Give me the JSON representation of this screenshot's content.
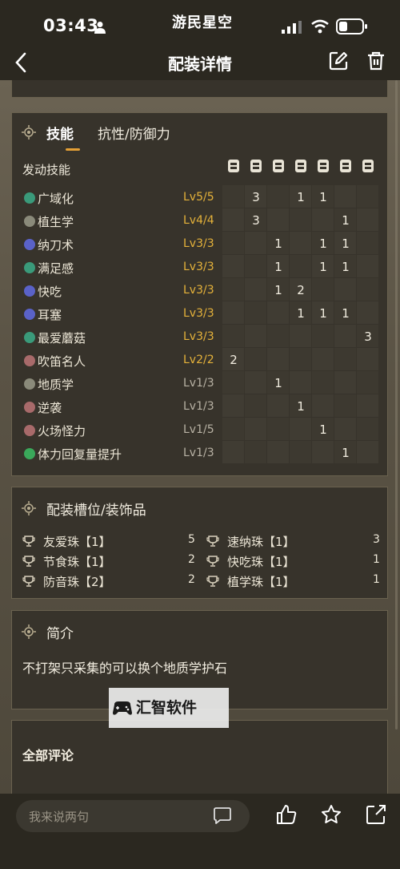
{
  "status": {
    "time": "03:43",
    "brand": "游民星空"
  },
  "nav": {
    "title": "配装详情"
  },
  "skills_panel": {
    "tabs": [
      {
        "label": "技能"
      },
      {
        "label": "抗性/防御力"
      }
    ],
    "header_label": "发动技能",
    "armor_icons": [
      "weapon-icon",
      "helmet-icon",
      "chest-icon",
      "arms-icon",
      "waist-icon",
      "legs-icon",
      "charm-icon"
    ],
    "skills": [
      {
        "name": "广域化",
        "level": "Lv5/5",
        "maxed": true,
        "color": "#3a9a7a",
        "cols": [
          "",
          "3",
          "",
          "1",
          "1",
          "",
          ""
        ]
      },
      {
        "name": "植生学",
        "level": "Lv4/4",
        "maxed": true,
        "color": "#8a8a7a",
        "cols": [
          "",
          "3",
          "",
          "",
          "",
          "1",
          ""
        ]
      },
      {
        "name": "纳刀术",
        "level": "Lv3/3",
        "maxed": true,
        "color": "#5a62c8",
        "cols": [
          "",
          "",
          "1",
          "",
          "1",
          "1",
          ""
        ]
      },
      {
        "name": "满足感",
        "level": "Lv3/3",
        "maxed": true,
        "color": "#3a9a7a",
        "cols": [
          "",
          "",
          "1",
          "",
          "1",
          "1",
          ""
        ]
      },
      {
        "name": "快吃",
        "level": "Lv3/3",
        "maxed": true,
        "color": "#5a62c8",
        "cols": [
          "",
          "",
          "1",
          "2",
          "",
          "",
          ""
        ]
      },
      {
        "name": "耳塞",
        "level": "Lv3/3",
        "maxed": true,
        "color": "#5a62c8",
        "cols": [
          "",
          "",
          "",
          "1",
          "1",
          "1",
          ""
        ]
      },
      {
        "name": "最爱蘑菇",
        "level": "Lv3/3",
        "maxed": true,
        "color": "#3a9a7a",
        "cols": [
          "",
          "",
          "",
          "",
          "",
          "",
          "3"
        ]
      },
      {
        "name": "吹笛名人",
        "level": "Lv2/2",
        "maxed": true,
        "color": "#a86a6a",
        "cols": [
          "2",
          "",
          "",
          "",
          "",
          "",
          ""
        ]
      },
      {
        "name": "地质学",
        "level": "Lv1/3",
        "maxed": false,
        "color": "#8a8a7a",
        "cols": [
          "",
          "",
          "1",
          "",
          "",
          "",
          ""
        ]
      },
      {
        "name": "逆袭",
        "level": "Lv1/3",
        "maxed": false,
        "color": "#a86a6a",
        "cols": [
          "",
          "",
          "",
          "1",
          "",
          "",
          ""
        ]
      },
      {
        "name": "火场怪力",
        "level": "Lv1/5",
        "maxed": false,
        "color": "#a86a6a",
        "cols": [
          "",
          "",
          "",
          "",
          "1",
          "",
          ""
        ]
      },
      {
        "name": "体力回复量提升",
        "level": "Lv1/3",
        "maxed": false,
        "color": "#3aa85a",
        "cols": [
          "",
          "",
          "",
          "",
          "",
          "1",
          ""
        ]
      }
    ],
    "level_colors": {
      "maxed": "#e5b23a",
      "partial": "#b8b2a4"
    }
  },
  "decorations_panel": {
    "title": "配装槽位/装饰品",
    "left": [
      {
        "name": "友爱珠【1】",
        "count": "5"
      },
      {
        "name": "节食珠【1】",
        "count": "2"
      },
      {
        "name": "防音珠【2】",
        "count": "2"
      }
    ],
    "right": [
      {
        "name": "速纳珠【1】",
        "count": "3"
      },
      {
        "name": "快吃珠【1】",
        "count": "1"
      },
      {
        "name": "植学珠【1】",
        "count": "1"
      }
    ]
  },
  "intro_panel": {
    "title": "简介",
    "text": "不打架只采集的可以换个地质学护石"
  },
  "watermark": {
    "text": "汇智软件"
  },
  "comments": {
    "title": "全部评论"
  },
  "bottom": {
    "input_placeholder": "我来说两句"
  },
  "colors": {
    "accent": "#e5a035",
    "panel": "#37332b",
    "border": "#6a624f"
  }
}
